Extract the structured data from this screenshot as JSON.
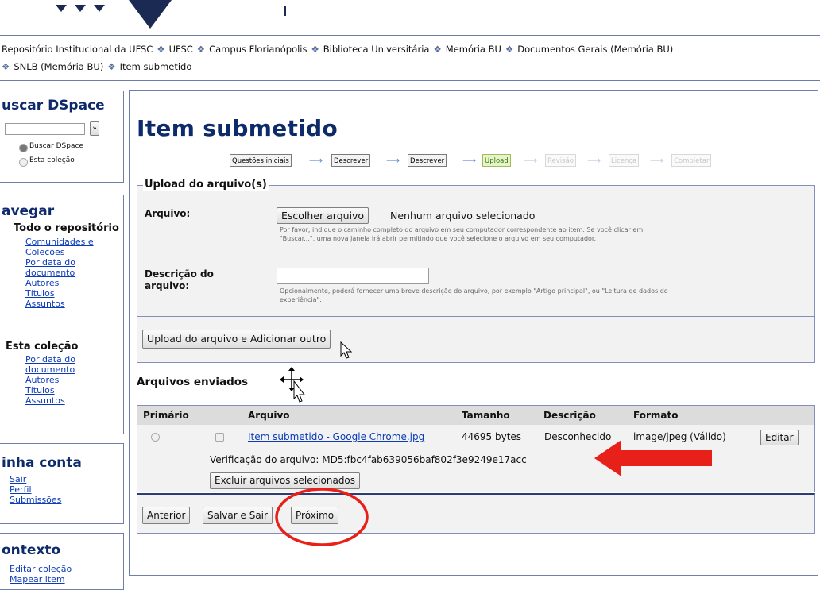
{
  "breadcrumb": {
    "items": [
      "Repositório Institucional da UFSC",
      "UFSC",
      "Campus Florianópolis",
      "Biblioteca Universitária",
      "Memória BU",
      "Documentos Gerais (Memória BU)",
      "SNLB (Memória BU)",
      "Item submetido"
    ],
    "separator": "❖"
  },
  "sidebar": {
    "search": {
      "title": "uscar DSpace",
      "go_label": "»",
      "opt_all": "Buscar DSpace",
      "opt_collection": "Esta coleção"
    },
    "navigate": {
      "title": "avegar",
      "repo_heading": "Todo o repositório",
      "repo_links": [
        "Comunidades e",
        "Coleções",
        "Por data do",
        "documento",
        "Autores",
        "Títulos",
        "Assuntos"
      ],
      "coll_heading": "Esta coleção",
      "coll_links": [
        "Por data do",
        "documento",
        "Autores",
        "Títulos",
        "Assuntos"
      ]
    },
    "account": {
      "title": "inha conta",
      "links": [
        "Sair",
        "Perfil",
        "Submissões"
      ]
    },
    "context": {
      "title": "ontexto",
      "links": [
        "Editar coleção",
        "Mapear item"
      ]
    }
  },
  "main": {
    "title": "Item submetido",
    "steps": [
      {
        "label": "Questões iniciais",
        "state": "done"
      },
      {
        "label": "Descrever",
        "state": "done"
      },
      {
        "label": "Descrever",
        "state": "done"
      },
      {
        "label": "Upload",
        "state": "active"
      },
      {
        "label": "Revisão",
        "state": "disabled"
      },
      {
        "label": "Licença",
        "state": "disabled"
      },
      {
        "label": "Completar",
        "state": "disabled"
      }
    ],
    "step_arrow": "⟶",
    "upload": {
      "legend": "Upload do arquivo(s)",
      "file_label": "Arquivo:",
      "choose_button": "Escolher arquivo",
      "no_file": "Nenhum arquivo selecionado",
      "file_help_1": "Por favor, indique o caminho completo do arquivo em seu computador correspondente ao item. Se você clicar em",
      "file_help_2": "\"Buscar...\", uma nova janela irá abrir permitindo que você selecione o arquivo em seu computador.",
      "desc_label_1": "Descrição do",
      "desc_label_2": "arquivo:",
      "desc_value": "",
      "desc_help_1": "Opcionalmente, poderá fornecer uma breve descrição do arquivo, por exemplo \"Artigo principal\", ou \"Leitura de dados do",
      "desc_help_2": "experiência\".",
      "upload_add_button": "Upload do arquivo e Adicionar outro"
    },
    "uploaded": {
      "title": "Arquivos enviados",
      "columns": [
        "Primário",
        "Arquivo",
        "Tamanho",
        "Descrição",
        "Formato"
      ],
      "row": {
        "file": "Item submetido - Google Chrome.jpg",
        "size": "44695 bytes",
        "description": "Desconhecido",
        "format": "image/jpeg (Válido)",
        "edit_button": "Editar"
      },
      "checksum": "Verificação do arquivo: MD5:fbc4fab639056baf802f3e9249e17acc",
      "delete_button": "Excluir arquivos selecionados"
    },
    "nav_buttons": {
      "previous": "Anterior",
      "save_exit": "Salvar e Sair",
      "next": "Próximo"
    }
  },
  "colors": {
    "title": "#0d2a6b",
    "link": "#0b3bb8",
    "annotation_red": "#e8201a",
    "border": "#6e7fa8"
  }
}
